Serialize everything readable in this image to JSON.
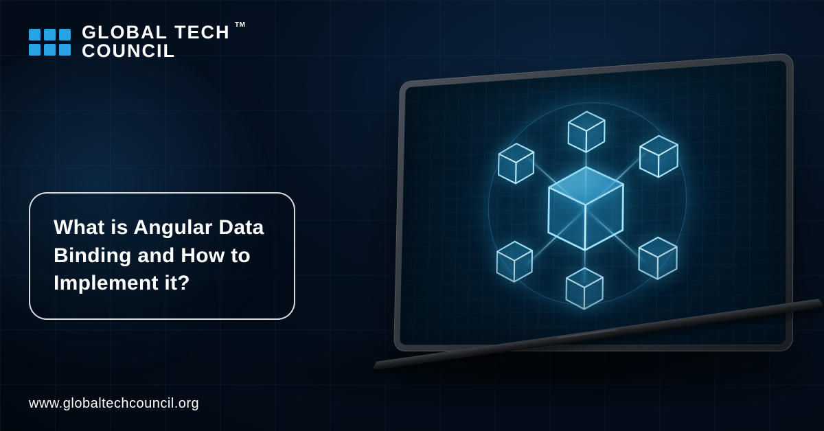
{
  "brand": {
    "line1": "GLOBAL TECH",
    "line2": "COUNCIL",
    "trademark": "TM",
    "accent_color": "#2aa3e6"
  },
  "headline": "What is Angular Data Binding and How to Implement it?",
  "url": "www.globaltechcouncil.org"
}
